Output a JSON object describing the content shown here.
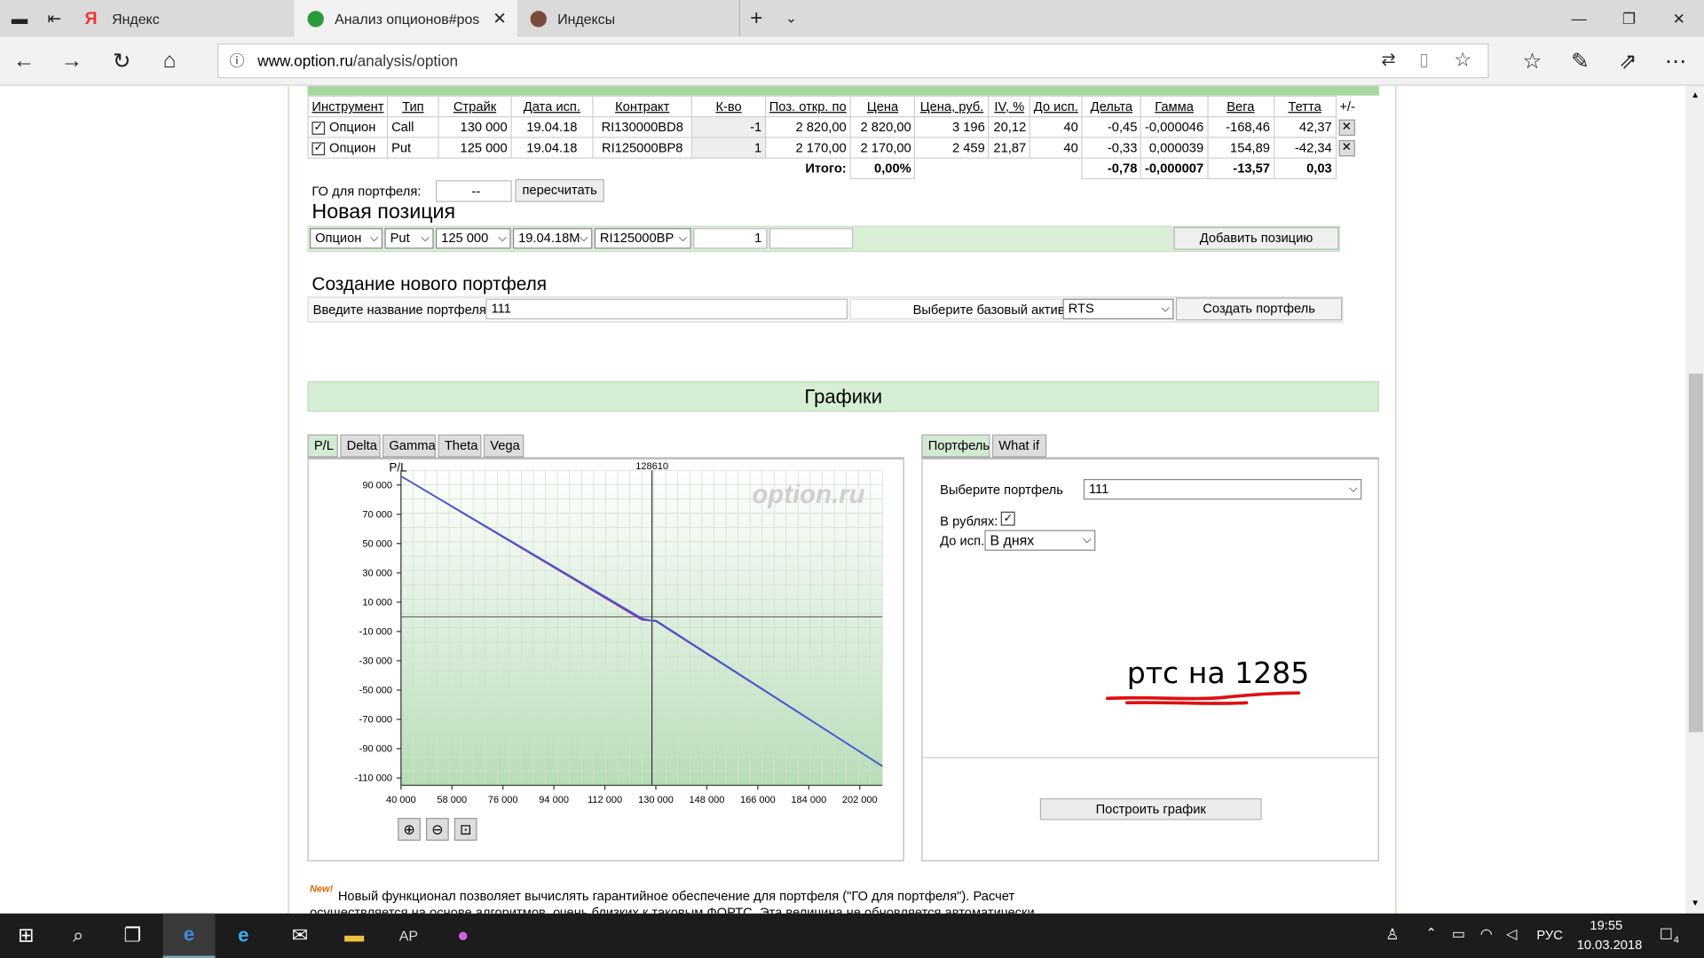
{
  "browser": {
    "tabs": [
      {
        "label": "Яндекс",
        "icon": "yandex-icon"
      },
      {
        "label": "Анализ опционов#pos",
        "icon": "option-icon"
      },
      {
        "label": "Индексы",
        "icon": "index-icon"
      }
    ],
    "url_domain": "www.option.ru",
    "url_path": "/analysis/option"
  },
  "portfolio_table": {
    "headers": [
      "Инструмент",
      "Тип",
      "Страйк",
      "Дата исп.",
      "Контракт",
      "К-во",
      "Поз. откр. по",
      "Цена",
      "Цена, руб.",
      "IV, %",
      "До исп.",
      "Дельта",
      "Гамма",
      "Вега",
      "Тетта",
      "+/-"
    ],
    "rows": [
      {
        "instrument": "Опцион",
        "type": "Call",
        "strike": "130 000",
        "date": "19.04.18",
        "contract": "RI130000BD8",
        "qty": "-1",
        "open": "2 820,00",
        "price": "2 820,00",
        "price_rub": "3 196",
        "iv": "20,12",
        "days": "40",
        "delta": "-0,45",
        "gamma": "-0,000046",
        "vega": "-168,46",
        "theta": "42,37"
      },
      {
        "instrument": "Опцион",
        "type": "Put",
        "strike": "125 000",
        "date": "19.04.18",
        "contract": "RI125000BP8",
        "qty": "1",
        "open": "2 170,00",
        "price": "2 170,00",
        "price_rub": "2 459",
        "iv": "21,87",
        "days": "40",
        "delta": "-0,33",
        "gamma": "0,000039",
        "vega": "154,89",
        "theta": "-42,34"
      }
    ],
    "total_label": "Итого:",
    "total_pct": "0,00%",
    "total_delta": "-0,78",
    "total_gamma": "-0,000007",
    "total_vega": "-13,57",
    "total_theta": "0,03"
  },
  "go": {
    "label": "ГО для портфеля:",
    "value": "--",
    "recalc": "пересчитать"
  },
  "new_position": {
    "title": "Новая позиция",
    "instrument": "Опцион",
    "type": "Put",
    "strike": "125 000",
    "date": "19.04.18М",
    "contract": "RI125000BP",
    "qty": "1",
    "add": "Добавить позицию"
  },
  "new_portfolio": {
    "title": "Создание нового портфеля",
    "name_label": "Введите название портфеля",
    "name_value": "111",
    "asset_label": "Выберите базовый актив",
    "asset_value": "RTS",
    "create": "Создать портфель"
  },
  "charts": {
    "title": "Графики",
    "tabs": [
      "P/L",
      "Delta",
      "Gamma",
      "Theta",
      "Vega"
    ],
    "right_tabs": [
      "Портфель",
      "What if"
    ],
    "choose_label": "Выберите портфель",
    "choose_value": "111",
    "rub_label": "В рублях:",
    "exp_label": "До исп.:",
    "exp_value": "В днях",
    "build": "Построить график",
    "annotation": "ртс на 1285",
    "watermark": "option.ru"
  },
  "chart_data": {
    "type": "line",
    "ylabel": "P/L",
    "marker_label": "128610",
    "marker_x": 128610,
    "xlim": [
      40000,
      210000
    ],
    "ylim": [
      -115000,
      100000
    ],
    "xticks": [
      "40 000",
      "58 000",
      "76 000",
      "94 000",
      "112 000",
      "130 000",
      "148 000",
      "166 000",
      "184 000",
      "202 000"
    ],
    "yticks": [
      "90 000",
      "70 000",
      "50 000",
      "30 000",
      "10 000",
      "-10 000",
      "-30 000",
      "-50 000",
      "-70 000",
      "-90 000",
      "-110 000"
    ],
    "xtick_vals": [
      40000,
      58000,
      76000,
      94000,
      112000,
      130000,
      148000,
      166000,
      184000,
      202000
    ],
    "ytick_vals": [
      90000,
      70000,
      50000,
      30000,
      10000,
      -10000,
      -30000,
      -50000,
      -70000,
      -90000,
      -110000
    ],
    "series": [
      {
        "color": "#a0308a",
        "x": [
          40000,
          125000,
          130000,
          210000
        ],
        "y": [
          96000,
          -2000,
          -3000,
          -102000
        ]
      },
      {
        "color": "#3a5ad8",
        "x": [
          40000,
          125000,
          128000,
          130000,
          210000
        ],
        "y": [
          96000,
          -1000,
          -2500,
          -2500,
          -102000
        ]
      }
    ]
  },
  "note": {
    "badge": "New!",
    "text1": "Новый функционал позволяет вычислять гарантийное обеспечение для портфеля (\"ГО для портфеля\"). Расчет",
    "text2": "осуществляется на основе алгоритмов, очень близких к таковым ФОРТС. Эта величина не обновляется автоматически"
  },
  "taskbar": {
    "lang": "РУС",
    "time": "19:55",
    "date": "10.03.2018",
    "badge": "4"
  }
}
